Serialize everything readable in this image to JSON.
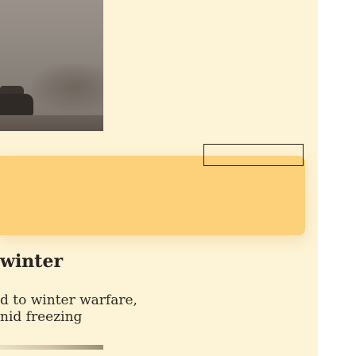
{
  "page": {
    "background_color": "#fdf3d6",
    "banner_color": "#fdd07a"
  },
  "article": {
    "image_icon": "photo-of-vehicle-in-fog",
    "title": "winter",
    "body_lines": [
      "d to winter warfare,",
      "nid freezing"
    ]
  }
}
